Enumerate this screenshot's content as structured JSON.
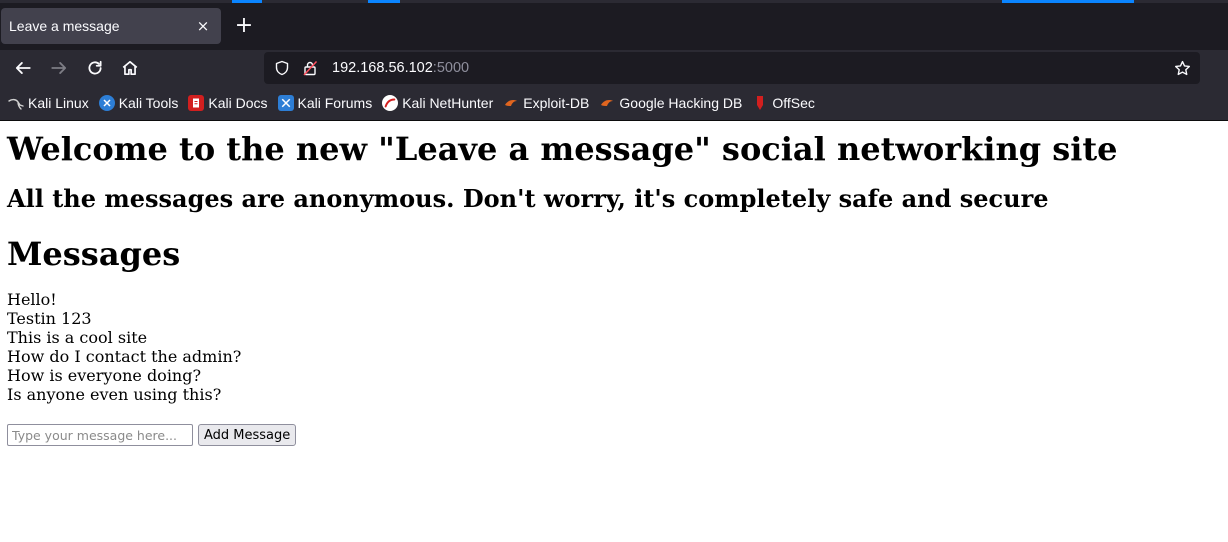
{
  "browser": {
    "tab_title": "Leave a message",
    "tab_close": "×",
    "new_tab": "+",
    "url_host": "192.168.56.102",
    "url_port": ":5000",
    "bookmarks": [
      {
        "label": "Kali Linux",
        "icon": "kali-dragon-icon",
        "color": "#cccccc"
      },
      {
        "label": "Kali Tools",
        "icon": "kali-tools-icon",
        "color": "#2d7ed6"
      },
      {
        "label": "Kali Docs",
        "icon": "kali-docs-icon",
        "color": "#d21f1f"
      },
      {
        "label": "Kali Forums",
        "icon": "kali-forums-icon",
        "color": "#2d7ed6"
      },
      {
        "label": "Kali NetHunter",
        "icon": "nethunter-icon",
        "color": "#d21f1f"
      },
      {
        "label": "Exploit-DB",
        "icon": "exploit-db-icon",
        "color": "#e0651f"
      },
      {
        "label": "Google Hacking DB",
        "icon": "ghdb-icon",
        "color": "#e0651f"
      },
      {
        "label": "OffSec",
        "icon": "offsec-icon",
        "color": "#d21f1f"
      }
    ]
  },
  "page": {
    "title": "Welcome to the new \"Leave a message\" social networking site",
    "subtitle": "All the messages are anonymous. Don't worry, it's completely safe and secure",
    "messages_heading": "Messages",
    "messages": [
      "Hello!",
      "Testin 123",
      "This is a cool site",
      "How do I contact the admin?",
      "How is everyone doing?",
      "Is anyone even using this?"
    ],
    "input_placeholder": "Type your message here...",
    "button_label": "Add Message"
  },
  "colors": {
    "chrome_dark": "#1c1b22",
    "toolbar": "#2b2a33",
    "accent": "#0a84ff"
  }
}
